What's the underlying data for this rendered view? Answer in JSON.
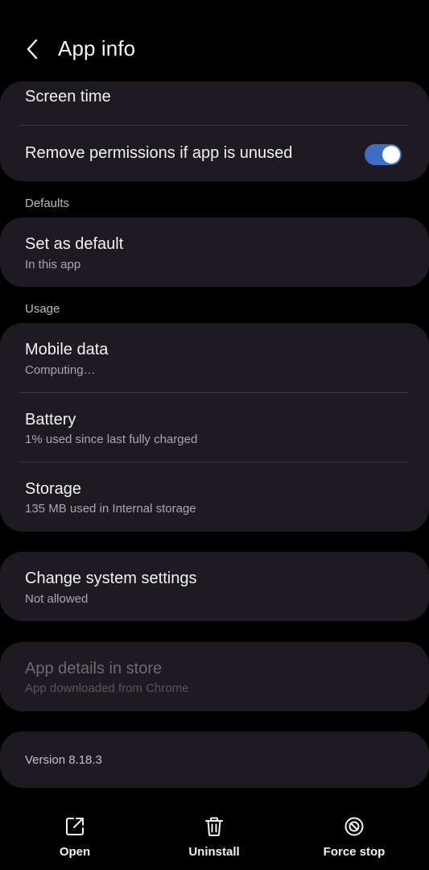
{
  "header": {
    "title": "App info",
    "back_icon": "back-arrow-icon"
  },
  "permissions_card": {
    "screen_time": "Screen time",
    "remove_permissions": "Remove permissions if app is unused",
    "remove_permissions_enabled": true
  },
  "defaults": {
    "section_label": "Defaults",
    "set_as_default": {
      "title": "Set as default",
      "subtitle": "In this app"
    }
  },
  "usage": {
    "section_label": "Usage",
    "mobile_data": {
      "title": "Mobile data",
      "subtitle": "Computing…"
    },
    "battery": {
      "title": "Battery",
      "subtitle": "1% used since last fully charged"
    },
    "storage": {
      "title": "Storage",
      "subtitle": "135 MB used in Internal storage"
    }
  },
  "system_settings": {
    "title": "Change system settings",
    "subtitle": "Not allowed"
  },
  "store": {
    "title": "App details in store",
    "subtitle": "App downloaded from Chrome",
    "enabled": false
  },
  "version": {
    "label": "Version 8.18.3"
  },
  "actions": {
    "open": {
      "label": "Open",
      "icon": "open-external-icon"
    },
    "uninstall": {
      "label": "Uninstall",
      "icon": "trash-icon"
    },
    "force_stop": {
      "label": "Force stop",
      "icon": "block-icon"
    }
  },
  "colors": {
    "background": "#000000",
    "card": "#1d1b21",
    "accent": "#3e6fc4",
    "secondary_text": "#a9a7ad"
  }
}
